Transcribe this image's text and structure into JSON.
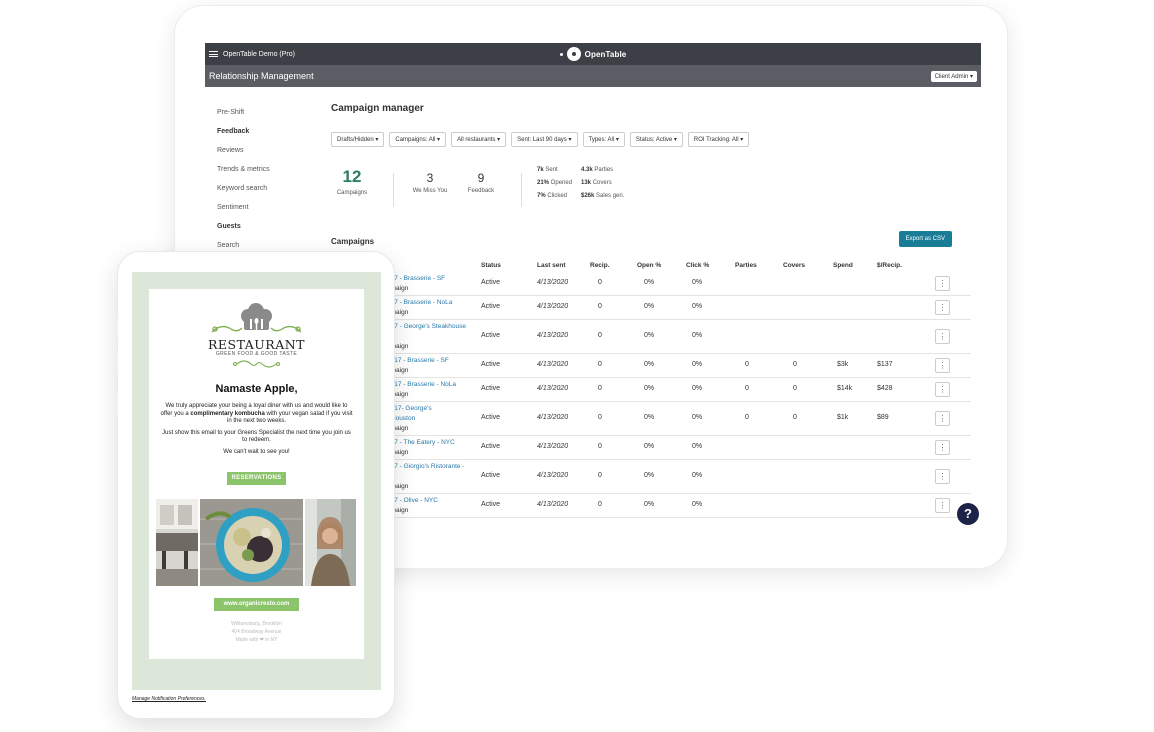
{
  "app": {
    "account": "OpenTable Demo (Pro)",
    "brand": "OpenTable",
    "section_title": "Relationship Management",
    "client_button": "Client Admin ▾"
  },
  "sidebar": {
    "items": [
      {
        "label": "Pre-Shift"
      },
      {
        "label": "Feedback",
        "header": true
      },
      {
        "label": "Reviews"
      },
      {
        "label": "Trends & metrics"
      },
      {
        "label": "Keyword search"
      },
      {
        "label": "Sentiment"
      },
      {
        "label": "Guests",
        "header": true
      },
      {
        "label": "Search"
      }
    ]
  },
  "main": {
    "title": "Campaign manager",
    "filters": [
      "Drafts/Hidden ▾",
      "Campaigns: All ▾",
      "All restaurants ▾",
      "Sent: Last 90 days ▾",
      "Types: All ▾",
      "Status: Active ▾",
      "ROI Tracking: All ▾"
    ],
    "stats": {
      "campaigns": {
        "value": "12",
        "label": "Campaigns"
      },
      "we_miss_you": {
        "value": "3",
        "label": "We Miss You"
      },
      "feedback": {
        "value": "9",
        "label": "Feedback"
      },
      "mini_left": [
        {
          "value": "7k",
          "label": "Sent"
        },
        {
          "value": "21%",
          "label": "Opened"
        },
        {
          "value": "7%",
          "label": "Clicked"
        }
      ],
      "mini_right": [
        {
          "value": "4.3k",
          "label": "Parties"
        },
        {
          "value": "13k",
          "label": "Covers"
        },
        {
          "value": "$26k",
          "label": "Sales gen."
        }
      ]
    },
    "campaigns_title": "Campaigns",
    "export_button": "Export as CSV",
    "columns": [
      "Status",
      "Last sent",
      "Recip.",
      "Open %",
      "Click %",
      "Parties",
      "Covers",
      "Spend",
      "$/Recip."
    ],
    "rows": [
      {
        "name": "017 - Brasserie - SF",
        "sub": "mpaign",
        "status": "Active",
        "last_sent": "4/13/2020",
        "recip": "0",
        "open": "0%",
        "click": "0%",
        "parties": "",
        "covers": "",
        "spend": "",
        "per_recip": ""
      },
      {
        "name": "017 - Brasserie - NoLa",
        "sub": "mpaign",
        "status": "Active",
        "last_sent": "4/13/2020",
        "recip": "0",
        "open": "0%",
        "click": "0%",
        "parties": "",
        "covers": "",
        "spend": "",
        "per_recip": ""
      },
      {
        "name": "017 - George's Steakhouse",
        "sub": "mpaign",
        "status": "Active",
        "last_sent": "4/13/2020",
        "recip": "0",
        "open": "0%",
        "click": "0%",
        "parties": "",
        "covers": "",
        "spend": "",
        "per_recip": ""
      },
      {
        "name": " 2017 - Brasserie - SF",
        "sub": "mpaign",
        "status": "Active",
        "last_sent": "4/13/2020",
        "recip": "0",
        "open": "0%",
        "click": "0%",
        "parties": "0",
        "covers": "0",
        "spend": "$3k",
        "per_recip": "$137"
      },
      {
        "name": " 2017 - Brasserie - NoLa",
        "sub": "mpaign",
        "status": "Active",
        "last_sent": "4/13/2020",
        "recip": "0",
        "open": "0%",
        "click": "0%",
        "parties": "0",
        "covers": "0",
        "spend": "$14k",
        "per_recip": "$428"
      },
      {
        "name": " 2017- George's",
        "name2": " - Houston",
        "sub": "mpaign",
        "status": "Active",
        "last_sent": "4/13/2020",
        "recip": "0",
        "open": "0%",
        "click": "0%",
        "parties": "0",
        "covers": "0",
        "spend": "$1k",
        "per_recip": "$89"
      },
      {
        "name": "017 - The Eatery - NYC",
        "sub": "mpaign",
        "status": "Active",
        "last_sent": "4/13/2020",
        "recip": "0",
        "open": "0%",
        "click": "0%",
        "parties": "",
        "covers": "",
        "spend": "",
        "per_recip": ""
      },
      {
        "name": "017 - Giorgio's Ristorante -",
        "sub": "mpaign",
        "status": "Active",
        "last_sent": "4/13/2020",
        "recip": "0",
        "open": "0%",
        "click": "0%",
        "parties": "",
        "covers": "",
        "spend": "",
        "per_recip": ""
      },
      {
        "name": "017 - Olive - NYC",
        "sub": "mpaign",
        "status": "Active",
        "last_sent": "4/13/2020",
        "recip": "0",
        "open": "0%",
        "click": "0%",
        "parties": "",
        "covers": "",
        "spend": "",
        "per_recip": ""
      }
    ],
    "kebab": "⋮",
    "help": "?"
  },
  "email": {
    "restaurant_name": "RESTAURANT",
    "tagline": "GREEN FOOD & GOOD TASTE",
    "greeting": "Namaste Apple,",
    "para1_a": "We truly appreciate your being a loyal diner with us and would like to offer you a ",
    "para1_bold": "complimentary kombucha",
    "para1_b": " with your vegan salad if you visit in the next two weeks.",
    "para2": "Just show this email to your Greens Specialist the next time you join us to redeem.",
    "para3": "We can't wait to see you!",
    "reservations_button": "RESERVATIONS",
    "url_button": "www.organicresto.com",
    "addr1": "Williamsburg, Brooklyn",
    "addr2": "404 Broadway Avenue",
    "addr3": "Made with ❤ in NY",
    "manage_link": "Manage Notification Preferences.",
    "colors": {
      "accent": "#8cc46b",
      "background": "#dce7d9"
    }
  },
  "colors": {
    "topbar": "#3c3f45",
    "export": "#1a7d98",
    "stat": "#2d7f5e",
    "link": "#2a7aa8"
  }
}
